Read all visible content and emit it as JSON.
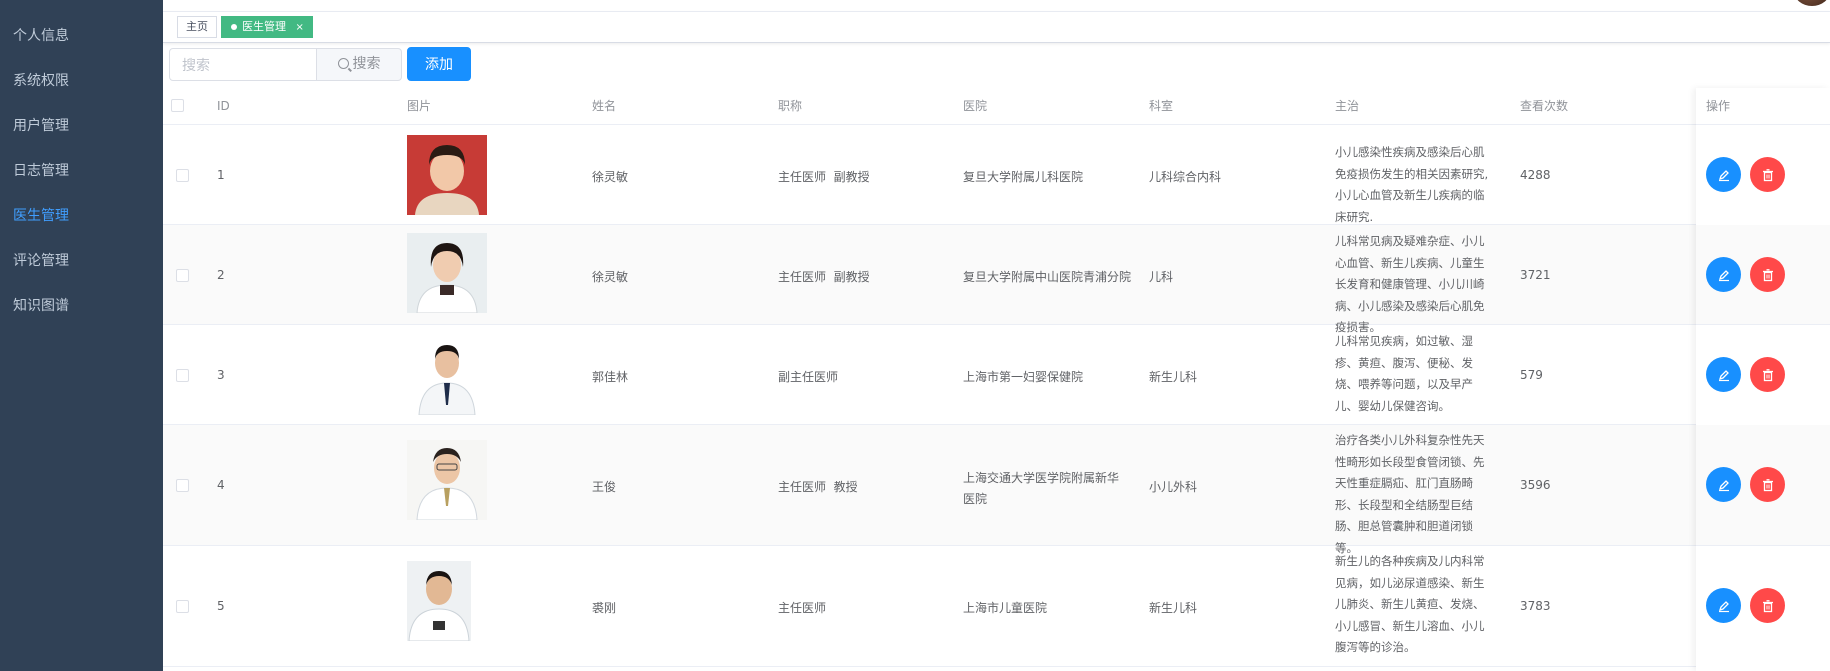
{
  "sidebar": {
    "items": [
      {
        "label": "个人信息",
        "active": false
      },
      {
        "label": "系统权限",
        "active": false
      },
      {
        "label": "用户管理",
        "active": false
      },
      {
        "label": "日志管理",
        "active": false
      },
      {
        "label": "医生管理",
        "active": true
      },
      {
        "label": "评论管理",
        "active": false
      },
      {
        "label": "知识图谱",
        "active": false
      }
    ]
  },
  "tags": {
    "home": "主页",
    "current": "医生管理",
    "close": "×"
  },
  "toolbar": {
    "search_placeholder": "搜索",
    "search_button": "搜索",
    "add_button": "添加"
  },
  "table": {
    "headers": {
      "id": "ID",
      "photo": "图片",
      "name": "姓名",
      "title": "职称",
      "hospital": "医院",
      "department": "科室",
      "specialty": "主治",
      "views": "查看次数",
      "actions": "操作"
    },
    "rows": [
      {
        "id": "1",
        "name": "徐灵敏",
        "title": "主任医师  副教授",
        "hospital": "复旦大学附属儿科医院",
        "department": "儿科综合内科",
        "specialty": "小儿感染性疾病及感染后心肌免疫损伤发生的相关因素研究,小儿心血管及新生儿疾病的临床研究.",
        "views": "4288"
      },
      {
        "id": "2",
        "name": "徐灵敏",
        "title": "主任医师  副教授",
        "hospital": "复旦大学附属中山医院青浦分院",
        "department": "儿科",
        "specialty": "儿科常见病及疑难杂症、小儿心血管、新生儿疾病、儿童生长发育和健康管理、小儿川崎病、小儿感染及感染后心肌免疫损害。",
        "views": "3721"
      },
      {
        "id": "3",
        "name": "郭佳林",
        "title": "副主任医师",
        "hospital": "上海市第一妇婴保健院",
        "department": "新生儿科",
        "specialty": "儿科常见疾病，如过敏、湿疹、黄疸、腹泻、便秘、发烧、喂养等问题，以及早产儿、婴幼儿保健咨询。",
        "views": "579"
      },
      {
        "id": "4",
        "name": "王俊",
        "title": "主任医师  教授",
        "hospital": "上海交通大学医学院附属新华医院",
        "department": "小儿外科",
        "specialty": "治疗各类小儿外科复杂性先天性畸形如长段型食管闭锁、先天性重症膈疝、肛门直肠畸形、长段型和全结肠型巨结肠、胆总管囊肿和胆道闭锁等。",
        "views": "3596"
      },
      {
        "id": "5",
        "name": "裘刚",
        "title": "主任医师",
        "hospital": "上海市儿童医院",
        "department": "新生儿科",
        "specialty": "新生儿的各种疾病及儿内科常见病，如儿泌尿道感染、新生儿肺炎、新生儿黄疸、发烧、小儿感冒、新生儿溶血、小儿腹泻等的诊治。",
        "views": "3783"
      }
    ]
  },
  "colors": {
    "sidebar_bg": "#304156",
    "sidebar_text": "#bfcbd9",
    "active_menu": "#409eff",
    "tag_active": "#42b983",
    "primary": "#1890ff",
    "danger": "#ff4949"
  }
}
